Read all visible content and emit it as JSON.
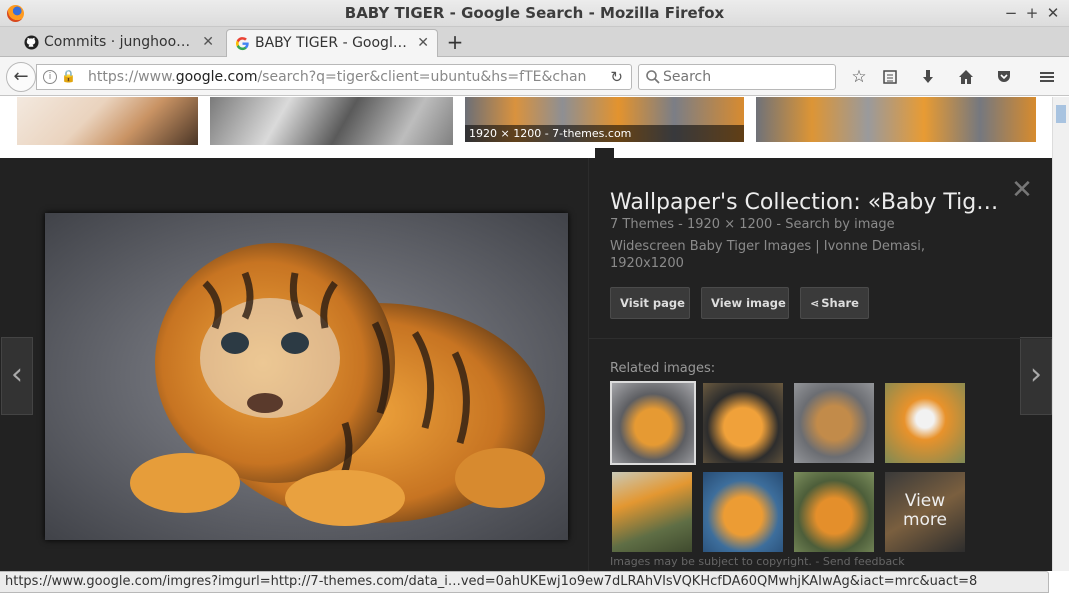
{
  "window": {
    "title": "BABY TIGER - Google Search - Mozilla Firefox",
    "controls": {
      "minimize": "−",
      "maximize": "+",
      "close": "✕"
    }
  },
  "tabs": [
    {
      "label": "Commits · junghoo…",
      "icon": "github-icon"
    },
    {
      "label": "BABY TIGER - Googl…",
      "icon": "google-icon",
      "active": true
    }
  ],
  "newtab_label": "+",
  "navbar": {
    "url_prefix": "https://www.",
    "url_host": "google.com",
    "url_path": "/search?q=tiger&client=ubuntu&hs=fTE&chan",
    "search_placeholder": "Search"
  },
  "thumbnails": {
    "caption": "1920 × 1200 - 7-themes.com"
  },
  "preview": {
    "title": "Wallpaper's Collection: «Baby Tig…",
    "meta": "7 Themes - 1920 × 1200 - Search by image",
    "description": "Widescreen Baby Tiger Images | Ivonne Demasi, 1920x1200",
    "buttons": {
      "visit": "Visit page",
      "view": "View image",
      "share": "Share"
    },
    "related_label": "Related images:",
    "view_more": "View more",
    "fineprint": "Images may be subject to copyright. - Send feedback"
  },
  "statusbar": {
    "text": "https://www.google.com/imgres?imgurl=http://7-themes.com/data_i…ved=0ahUKEwj1o9ew7dLRAhVIsVQKHcfDA60QMwhjKAIwAg&iact=mrc&uact=8"
  },
  "colors": {
    "panel_bg": "#222222",
    "accent_orange": "#d88a32",
    "titlebar": "#dcdcdc"
  }
}
